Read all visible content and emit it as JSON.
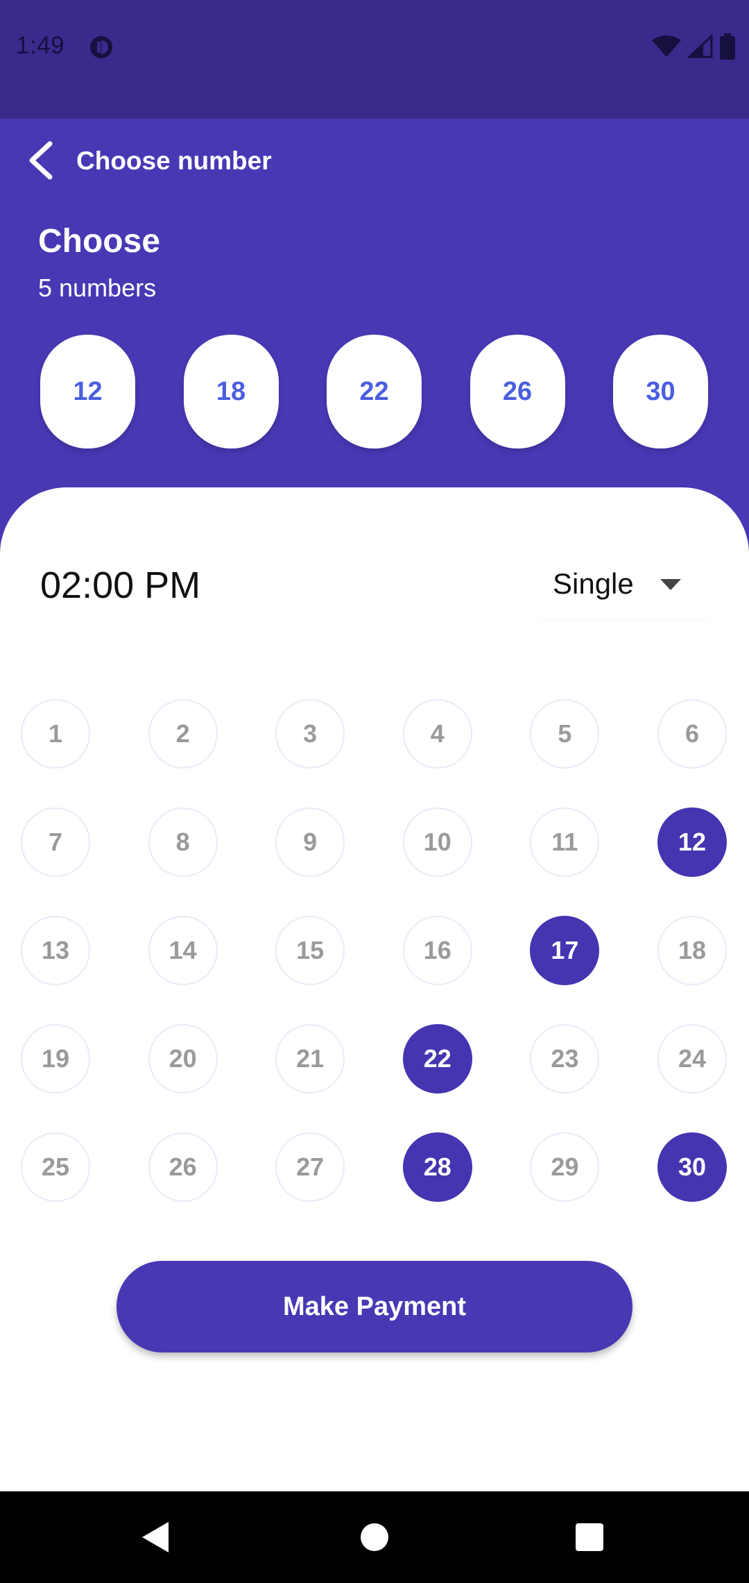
{
  "status_bar": {
    "time": "1:49"
  },
  "app_bar": {
    "title": "Choose number"
  },
  "header": {
    "title": "Choose",
    "subtitle": "5 numbers"
  },
  "picked_numbers": [
    "12",
    "18",
    "22",
    "26",
    "30"
  ],
  "draw": {
    "time": "02:00 PM",
    "type": "Single"
  },
  "numbers": [
    {
      "n": "1",
      "selected": false
    },
    {
      "n": "2",
      "selected": false
    },
    {
      "n": "3",
      "selected": false
    },
    {
      "n": "4",
      "selected": false
    },
    {
      "n": "5",
      "selected": false
    },
    {
      "n": "6",
      "selected": false
    },
    {
      "n": "7",
      "selected": false
    },
    {
      "n": "8",
      "selected": false
    },
    {
      "n": "9",
      "selected": false
    },
    {
      "n": "10",
      "selected": false
    },
    {
      "n": "11",
      "selected": false
    },
    {
      "n": "12",
      "selected": true
    },
    {
      "n": "13",
      "selected": false
    },
    {
      "n": "14",
      "selected": false
    },
    {
      "n": "15",
      "selected": false
    },
    {
      "n": "16",
      "selected": false
    },
    {
      "n": "17",
      "selected": true
    },
    {
      "n": "18",
      "selected": false
    },
    {
      "n": "19",
      "selected": false
    },
    {
      "n": "20",
      "selected": false
    },
    {
      "n": "21",
      "selected": false
    },
    {
      "n": "22",
      "selected": true
    },
    {
      "n": "23",
      "selected": false
    },
    {
      "n": "24",
      "selected": false
    },
    {
      "n": "25",
      "selected": false
    },
    {
      "n": "26",
      "selected": false
    },
    {
      "n": "27",
      "selected": false
    },
    {
      "n": "28",
      "selected": true
    },
    {
      "n": "29",
      "selected": false
    },
    {
      "n": "30",
      "selected": true
    }
  ],
  "actions": {
    "pay_label": "Make Payment"
  },
  "colors": {
    "primary": "#4838b4",
    "status_bar": "#3a2a8c",
    "picked_text": "#4a5ee0",
    "selected_ball": "#4535b0"
  }
}
